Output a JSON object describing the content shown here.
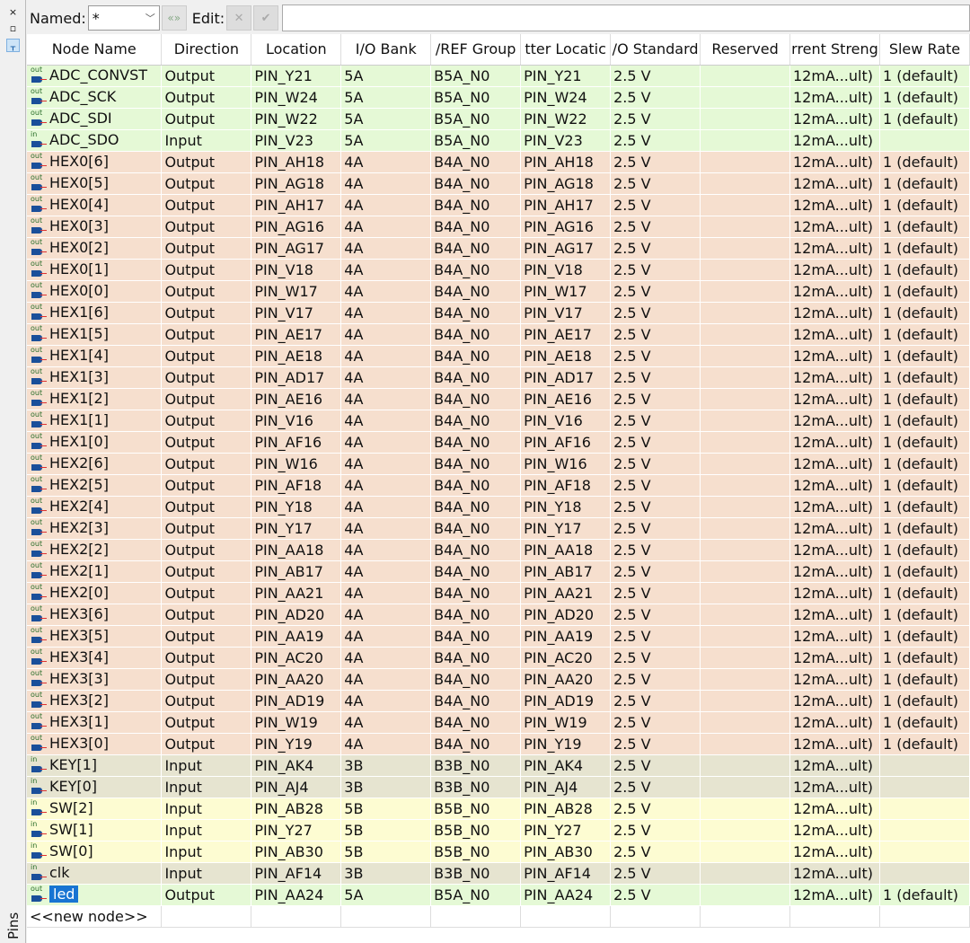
{
  "sidebar": {
    "close": "×",
    "float": "🗗",
    "pin": "📌",
    "label": "Pins"
  },
  "toolbar": {
    "named_label": "Named:",
    "named_value": "*",
    "edit_label": "Edit:",
    "cancel": "✕",
    "accept": "✔",
    "edit_value": ""
  },
  "columns": [
    "Node Name",
    "Direction",
    "Location",
    "I/O Bank",
    "VREF Group",
    "Fitter Location",
    "I/O Standard",
    "Reserved",
    "Current Strength",
    "Slew Rate"
  ],
  "columns_visible": [
    "Node Name",
    "Direction",
    "Location",
    "I/O Bank",
    "/REF Group",
    "tter Locatic",
    "/O Standard",
    "Reserved",
    "rrent Streng",
    "Slew Rate"
  ],
  "colors": {
    "bank5A": "#e5f9d6",
    "bank4A": "#f6dfce",
    "bank3B": "#e6e4d0",
    "bank5B": "#fdfcd2",
    "selected": "#1874d2"
  },
  "rows": [
    [
      "ADC_CONVST",
      "Output",
      "PIN_Y21",
      "5A",
      "B5A_N0",
      "PIN_Y21",
      "2.5 V",
      "",
      "12mA...ult)",
      "1 (default)"
    ],
    [
      "ADC_SCK",
      "Output",
      "PIN_W24",
      "5A",
      "B5A_N0",
      "PIN_W24",
      "2.5 V",
      "",
      "12mA...ult)",
      "1 (default)"
    ],
    [
      "ADC_SDI",
      "Output",
      "PIN_W22",
      "5A",
      "B5A_N0",
      "PIN_W22",
      "2.5 V",
      "",
      "12mA...ult)",
      "1 (default)"
    ],
    [
      "ADC_SDO",
      "Input",
      "PIN_V23",
      "5A",
      "B5A_N0",
      "PIN_V23",
      "2.5 V",
      "",
      "12mA...ult)",
      ""
    ],
    [
      "HEX0[6]",
      "Output",
      "PIN_AH18",
      "4A",
      "B4A_N0",
      "PIN_AH18",
      "2.5 V",
      "",
      "12mA...ult)",
      "1 (default)"
    ],
    [
      "HEX0[5]",
      "Output",
      "PIN_AG18",
      "4A",
      "B4A_N0",
      "PIN_AG18",
      "2.5 V",
      "",
      "12mA...ult)",
      "1 (default)"
    ],
    [
      "HEX0[4]",
      "Output",
      "PIN_AH17",
      "4A",
      "B4A_N0",
      "PIN_AH17",
      "2.5 V",
      "",
      "12mA...ult)",
      "1 (default)"
    ],
    [
      "HEX0[3]",
      "Output",
      "PIN_AG16",
      "4A",
      "B4A_N0",
      "PIN_AG16",
      "2.5 V",
      "",
      "12mA...ult)",
      "1 (default)"
    ],
    [
      "HEX0[2]",
      "Output",
      "PIN_AG17",
      "4A",
      "B4A_N0",
      "PIN_AG17",
      "2.5 V",
      "",
      "12mA...ult)",
      "1 (default)"
    ],
    [
      "HEX0[1]",
      "Output",
      "PIN_V18",
      "4A",
      "B4A_N0",
      "PIN_V18",
      "2.5 V",
      "",
      "12mA...ult)",
      "1 (default)"
    ],
    [
      "HEX0[0]",
      "Output",
      "PIN_W17",
      "4A",
      "B4A_N0",
      "PIN_W17",
      "2.5 V",
      "",
      "12mA...ult)",
      "1 (default)"
    ],
    [
      "HEX1[6]",
      "Output",
      "PIN_V17",
      "4A",
      "B4A_N0",
      "PIN_V17",
      "2.5 V",
      "",
      "12mA...ult)",
      "1 (default)"
    ],
    [
      "HEX1[5]",
      "Output",
      "PIN_AE17",
      "4A",
      "B4A_N0",
      "PIN_AE17",
      "2.5 V",
      "",
      "12mA...ult)",
      "1 (default)"
    ],
    [
      "HEX1[4]",
      "Output",
      "PIN_AE18",
      "4A",
      "B4A_N0",
      "PIN_AE18",
      "2.5 V",
      "",
      "12mA...ult)",
      "1 (default)"
    ],
    [
      "HEX1[3]",
      "Output",
      "PIN_AD17",
      "4A",
      "B4A_N0",
      "PIN_AD17",
      "2.5 V",
      "",
      "12mA...ult)",
      "1 (default)"
    ],
    [
      "HEX1[2]",
      "Output",
      "PIN_AE16",
      "4A",
      "B4A_N0",
      "PIN_AE16",
      "2.5 V",
      "",
      "12mA...ult)",
      "1 (default)"
    ],
    [
      "HEX1[1]",
      "Output",
      "PIN_V16",
      "4A",
      "B4A_N0",
      "PIN_V16",
      "2.5 V",
      "",
      "12mA...ult)",
      "1 (default)"
    ],
    [
      "HEX1[0]",
      "Output",
      "PIN_AF16",
      "4A",
      "B4A_N0",
      "PIN_AF16",
      "2.5 V",
      "",
      "12mA...ult)",
      "1 (default)"
    ],
    [
      "HEX2[6]",
      "Output",
      "PIN_W16",
      "4A",
      "B4A_N0",
      "PIN_W16",
      "2.5 V",
      "",
      "12mA...ult)",
      "1 (default)"
    ],
    [
      "HEX2[5]",
      "Output",
      "PIN_AF18",
      "4A",
      "B4A_N0",
      "PIN_AF18",
      "2.5 V",
      "",
      "12mA...ult)",
      "1 (default)"
    ],
    [
      "HEX2[4]",
      "Output",
      "PIN_Y18",
      "4A",
      "B4A_N0",
      "PIN_Y18",
      "2.5 V",
      "",
      "12mA...ult)",
      "1 (default)"
    ],
    [
      "HEX2[3]",
      "Output",
      "PIN_Y17",
      "4A",
      "B4A_N0",
      "PIN_Y17",
      "2.5 V",
      "",
      "12mA...ult)",
      "1 (default)"
    ],
    [
      "HEX2[2]",
      "Output",
      "PIN_AA18",
      "4A",
      "B4A_N0",
      "PIN_AA18",
      "2.5 V",
      "",
      "12mA...ult)",
      "1 (default)"
    ],
    [
      "HEX2[1]",
      "Output",
      "PIN_AB17",
      "4A",
      "B4A_N0",
      "PIN_AB17",
      "2.5 V",
      "",
      "12mA...ult)",
      "1 (default)"
    ],
    [
      "HEX2[0]",
      "Output",
      "PIN_AA21",
      "4A",
      "B4A_N0",
      "PIN_AA21",
      "2.5 V",
      "",
      "12mA...ult)",
      "1 (default)"
    ],
    [
      "HEX3[6]",
      "Output",
      "PIN_AD20",
      "4A",
      "B4A_N0",
      "PIN_AD20",
      "2.5 V",
      "",
      "12mA...ult)",
      "1 (default)"
    ],
    [
      "HEX3[5]",
      "Output",
      "PIN_AA19",
      "4A",
      "B4A_N0",
      "PIN_AA19",
      "2.5 V",
      "",
      "12mA...ult)",
      "1 (default)"
    ],
    [
      "HEX3[4]",
      "Output",
      "PIN_AC20",
      "4A",
      "B4A_N0",
      "PIN_AC20",
      "2.5 V",
      "",
      "12mA...ult)",
      "1 (default)"
    ],
    [
      "HEX3[3]",
      "Output",
      "PIN_AA20",
      "4A",
      "B4A_N0",
      "PIN_AA20",
      "2.5 V",
      "",
      "12mA...ult)",
      "1 (default)"
    ],
    [
      "HEX3[2]",
      "Output",
      "PIN_AD19",
      "4A",
      "B4A_N0",
      "PIN_AD19",
      "2.5 V",
      "",
      "12mA...ult)",
      "1 (default)"
    ],
    [
      "HEX3[1]",
      "Output",
      "PIN_W19",
      "4A",
      "B4A_N0",
      "PIN_W19",
      "2.5 V",
      "",
      "12mA...ult)",
      "1 (default)"
    ],
    [
      "HEX3[0]",
      "Output",
      "PIN_Y19",
      "4A",
      "B4A_N0",
      "PIN_Y19",
      "2.5 V",
      "",
      "12mA...ult)",
      "1 (default)"
    ],
    [
      "KEY[1]",
      "Input",
      "PIN_AK4",
      "3B",
      "B3B_N0",
      "PIN_AK4",
      "2.5 V",
      "",
      "12mA...ult)",
      ""
    ],
    [
      "KEY[0]",
      "Input",
      "PIN_AJ4",
      "3B",
      "B3B_N0",
      "PIN_AJ4",
      "2.5 V",
      "",
      "12mA...ult)",
      ""
    ],
    [
      "SW[2]",
      "Input",
      "PIN_AB28",
      "5B",
      "B5B_N0",
      "PIN_AB28",
      "2.5 V",
      "",
      "12mA...ult)",
      ""
    ],
    [
      "SW[1]",
      "Input",
      "PIN_Y27",
      "5B",
      "B5B_N0",
      "PIN_Y27",
      "2.5 V",
      "",
      "12mA...ult)",
      ""
    ],
    [
      "SW[0]",
      "Input",
      "PIN_AB30",
      "5B",
      "B5B_N0",
      "PIN_AB30",
      "2.5 V",
      "",
      "12mA...ult)",
      ""
    ],
    [
      "clk",
      "Input",
      "PIN_AF14",
      "3B",
      "B3B_N0",
      "PIN_AF14",
      "2.5 V",
      "",
      "12mA...ult)",
      ""
    ],
    [
      "led",
      "Output",
      "PIN_AA24",
      "5A",
      "B5A_N0",
      "PIN_AA24",
      "2.5 V",
      "",
      "12mA...ult)",
      "1 (default)"
    ]
  ],
  "selected_row": "led",
  "new_node": "<<new node>>",
  "icon_labels": {
    "out": "out",
    "in": "in"
  }
}
